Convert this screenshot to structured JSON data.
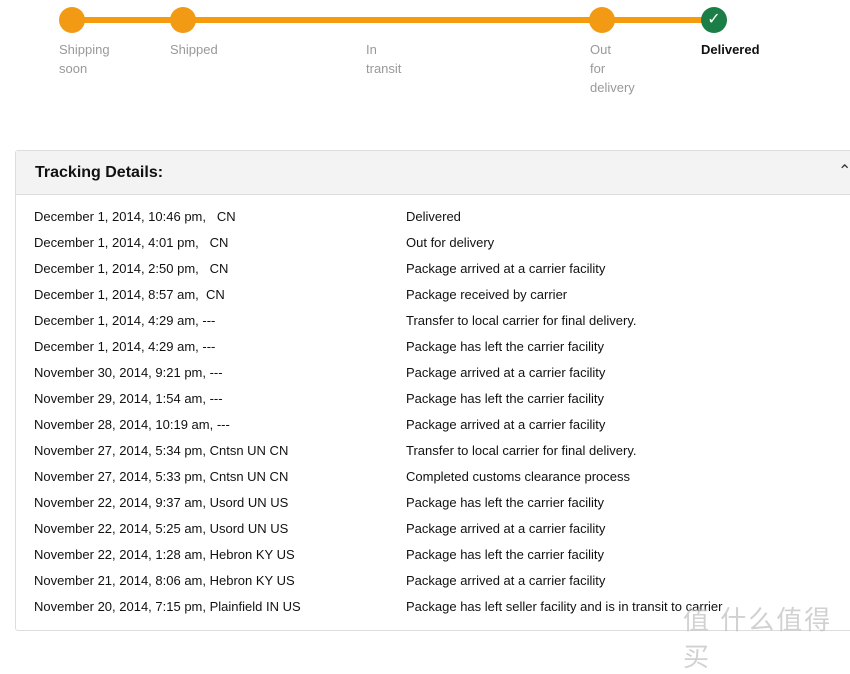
{
  "progress": {
    "steps": [
      {
        "label": [
          "Shipping",
          "soon"
        ],
        "state": "done"
      },
      {
        "label": [
          "Shipped"
        ],
        "state": "done"
      },
      {
        "label": [
          "In",
          "transit"
        ],
        "state": "skipped"
      },
      {
        "label": [
          "Out",
          "for",
          "delivery"
        ],
        "state": "done"
      },
      {
        "label": [
          "Delivered"
        ],
        "state": "current"
      }
    ],
    "colors": {
      "accent": "#f59b0c",
      "complete": "#1b7e46"
    }
  },
  "tracking": {
    "title": "Tracking Details:",
    "rows": [
      {
        "date": "December 1, 2014, 10:46 pm,   CN",
        "status": "Delivered"
      },
      {
        "date": "December 1, 2014, 4:01 pm,   CN",
        "status": "Out for delivery"
      },
      {
        "date": "December 1, 2014, 2:50 pm,   CN",
        "status": "Package arrived at a carrier facility"
      },
      {
        "date": "December 1, 2014, 8:57 am,  CN",
        "status": "Package received by carrier"
      },
      {
        "date": "December 1, 2014, 4:29 am, ---",
        "status": "Transfer to local carrier for final delivery."
      },
      {
        "date": "December 1, 2014, 4:29 am, ---",
        "status": "Package has left the carrier facility"
      },
      {
        "date": "November 30, 2014, 9:21 pm, ---",
        "status": "Package arrived at a carrier facility"
      },
      {
        "date": "November 29, 2014, 1:54 am, ---",
        "status": "Package has left the carrier facility"
      },
      {
        "date": "November 28, 2014, 10:19 am, ---",
        "status": "Package arrived at a carrier facility"
      },
      {
        "date": "November 27, 2014, 5:34 pm, Cntsn UN CN",
        "status": "Transfer to local carrier for final delivery."
      },
      {
        "date": "November 27, 2014, 5:33 pm, Cntsn UN CN",
        "status": "Completed customs clearance process"
      },
      {
        "date": "November 22, 2014, 9:37 am, Usord UN US",
        "status": "Package has left the carrier facility"
      },
      {
        "date": "November 22, 2014, 5:25 am, Usord UN US",
        "status": "Package arrived at a carrier facility"
      },
      {
        "date": "November 22, 2014, 1:28 am, Hebron KY US",
        "status": "Package has left the carrier facility"
      },
      {
        "date": "November 21, 2014, 8:06 am, Hebron KY US",
        "status": "Package arrived at a carrier facility"
      },
      {
        "date": "November 20, 2014, 7:15 pm, Plainfield IN US",
        "status": "Package has left seller facility and is in transit to carrier"
      }
    ]
  },
  "watermark": "值 什么值得买"
}
